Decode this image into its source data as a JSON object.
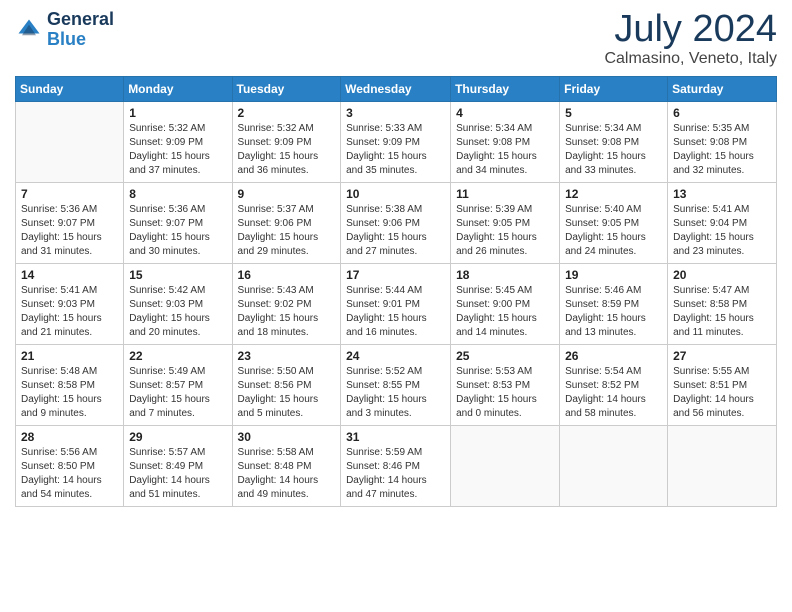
{
  "header": {
    "logo_general": "General",
    "logo_blue": "Blue",
    "month": "July 2024",
    "location": "Calmasino, Veneto, Italy"
  },
  "weekdays": [
    "Sunday",
    "Monday",
    "Tuesday",
    "Wednesday",
    "Thursday",
    "Friday",
    "Saturday"
  ],
  "weeks": [
    [
      {
        "day": "",
        "info": ""
      },
      {
        "day": "1",
        "info": "Sunrise: 5:32 AM\nSunset: 9:09 PM\nDaylight: 15 hours\nand 37 minutes."
      },
      {
        "day": "2",
        "info": "Sunrise: 5:32 AM\nSunset: 9:09 PM\nDaylight: 15 hours\nand 36 minutes."
      },
      {
        "day": "3",
        "info": "Sunrise: 5:33 AM\nSunset: 9:09 PM\nDaylight: 15 hours\nand 35 minutes."
      },
      {
        "day": "4",
        "info": "Sunrise: 5:34 AM\nSunset: 9:08 PM\nDaylight: 15 hours\nand 34 minutes."
      },
      {
        "day": "5",
        "info": "Sunrise: 5:34 AM\nSunset: 9:08 PM\nDaylight: 15 hours\nand 33 minutes."
      },
      {
        "day": "6",
        "info": "Sunrise: 5:35 AM\nSunset: 9:08 PM\nDaylight: 15 hours\nand 32 minutes."
      }
    ],
    [
      {
        "day": "7",
        "info": "Sunrise: 5:36 AM\nSunset: 9:07 PM\nDaylight: 15 hours\nand 31 minutes."
      },
      {
        "day": "8",
        "info": "Sunrise: 5:36 AM\nSunset: 9:07 PM\nDaylight: 15 hours\nand 30 minutes."
      },
      {
        "day": "9",
        "info": "Sunrise: 5:37 AM\nSunset: 9:06 PM\nDaylight: 15 hours\nand 29 minutes."
      },
      {
        "day": "10",
        "info": "Sunrise: 5:38 AM\nSunset: 9:06 PM\nDaylight: 15 hours\nand 27 minutes."
      },
      {
        "day": "11",
        "info": "Sunrise: 5:39 AM\nSunset: 9:05 PM\nDaylight: 15 hours\nand 26 minutes."
      },
      {
        "day": "12",
        "info": "Sunrise: 5:40 AM\nSunset: 9:05 PM\nDaylight: 15 hours\nand 24 minutes."
      },
      {
        "day": "13",
        "info": "Sunrise: 5:41 AM\nSunset: 9:04 PM\nDaylight: 15 hours\nand 23 minutes."
      }
    ],
    [
      {
        "day": "14",
        "info": "Sunrise: 5:41 AM\nSunset: 9:03 PM\nDaylight: 15 hours\nand 21 minutes."
      },
      {
        "day": "15",
        "info": "Sunrise: 5:42 AM\nSunset: 9:03 PM\nDaylight: 15 hours\nand 20 minutes."
      },
      {
        "day": "16",
        "info": "Sunrise: 5:43 AM\nSunset: 9:02 PM\nDaylight: 15 hours\nand 18 minutes."
      },
      {
        "day": "17",
        "info": "Sunrise: 5:44 AM\nSunset: 9:01 PM\nDaylight: 15 hours\nand 16 minutes."
      },
      {
        "day": "18",
        "info": "Sunrise: 5:45 AM\nSunset: 9:00 PM\nDaylight: 15 hours\nand 14 minutes."
      },
      {
        "day": "19",
        "info": "Sunrise: 5:46 AM\nSunset: 8:59 PM\nDaylight: 15 hours\nand 13 minutes."
      },
      {
        "day": "20",
        "info": "Sunrise: 5:47 AM\nSunset: 8:58 PM\nDaylight: 15 hours\nand 11 minutes."
      }
    ],
    [
      {
        "day": "21",
        "info": "Sunrise: 5:48 AM\nSunset: 8:58 PM\nDaylight: 15 hours\nand 9 minutes."
      },
      {
        "day": "22",
        "info": "Sunrise: 5:49 AM\nSunset: 8:57 PM\nDaylight: 15 hours\nand 7 minutes."
      },
      {
        "day": "23",
        "info": "Sunrise: 5:50 AM\nSunset: 8:56 PM\nDaylight: 15 hours\nand 5 minutes."
      },
      {
        "day": "24",
        "info": "Sunrise: 5:52 AM\nSunset: 8:55 PM\nDaylight: 15 hours\nand 3 minutes."
      },
      {
        "day": "25",
        "info": "Sunrise: 5:53 AM\nSunset: 8:53 PM\nDaylight: 15 hours\nand 0 minutes."
      },
      {
        "day": "26",
        "info": "Sunrise: 5:54 AM\nSunset: 8:52 PM\nDaylight: 14 hours\nand 58 minutes."
      },
      {
        "day": "27",
        "info": "Sunrise: 5:55 AM\nSunset: 8:51 PM\nDaylight: 14 hours\nand 56 minutes."
      }
    ],
    [
      {
        "day": "28",
        "info": "Sunrise: 5:56 AM\nSunset: 8:50 PM\nDaylight: 14 hours\nand 54 minutes."
      },
      {
        "day": "29",
        "info": "Sunrise: 5:57 AM\nSunset: 8:49 PM\nDaylight: 14 hours\nand 51 minutes."
      },
      {
        "day": "30",
        "info": "Sunrise: 5:58 AM\nSunset: 8:48 PM\nDaylight: 14 hours\nand 49 minutes."
      },
      {
        "day": "31",
        "info": "Sunrise: 5:59 AM\nSunset: 8:46 PM\nDaylight: 14 hours\nand 47 minutes."
      },
      {
        "day": "",
        "info": ""
      },
      {
        "day": "",
        "info": ""
      },
      {
        "day": "",
        "info": ""
      }
    ]
  ]
}
